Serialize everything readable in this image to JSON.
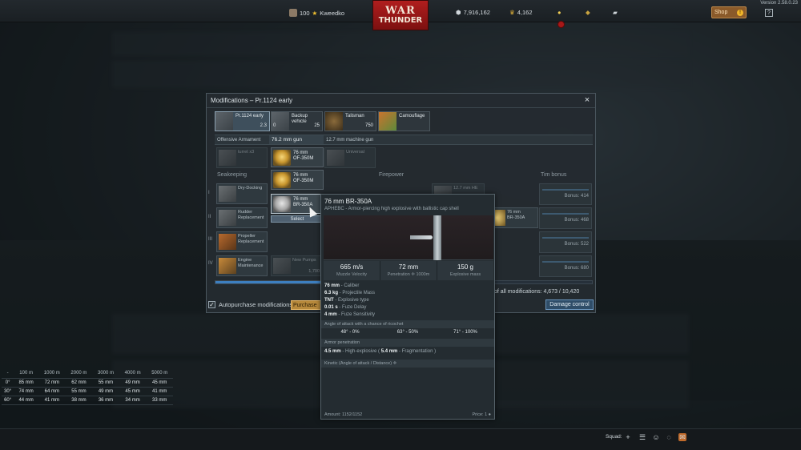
{
  "version": "Version 2.58.0.23",
  "topbar": {
    "rank": "100",
    "username": "Kweedko",
    "logo_top": "WAR",
    "logo_bottom": "THUNDER",
    "silver_lions": "7,916,162",
    "golden_eagles": "4,162",
    "shop_label": "Shop",
    "shop_badge": "!",
    "help_label": "?"
  },
  "modal": {
    "title": "Modifications – Pr.1124 early",
    "close": "×",
    "slots": [
      {
        "name": "Pr.1124 early",
        "sub": "2.3"
      },
      {
        "name": "Backup vehicle",
        "count": "0",
        "cost": "25"
      },
      {
        "name": "Talisman",
        "cost": "750"
      },
      {
        "name": "Camouflage"
      }
    ],
    "armament": {
      "label": "Offensive Armament",
      "weapon1": "76.2 mm gun",
      "weapon2": "12.7 mm machine gun"
    },
    "row0": {
      "turret": "turret x3",
      "universal": "Universal"
    },
    "shells": [
      {
        "line1": "76 mm",
        "line2": "OF-350M"
      },
      {
        "line1": "76 mm",
        "line2": "OF-350M"
      },
      {
        "line1": "76 mm",
        "line2": "BR-350A"
      }
    ],
    "select_label": "Select",
    "categories": {
      "seakeeping": "Seakeeping",
      "firepower": "Firepower",
      "tim_bonus": "Tim bonus"
    },
    "roman": [
      "I",
      "II",
      "III",
      "IV"
    ],
    "mods": [
      {
        "line1": "Dry-Docking",
        "line2": ""
      },
      {
        "line1": "Rudder",
        "line2": "Replacement"
      },
      {
        "line1": "Propeller",
        "line2": "Replacement"
      },
      {
        "line1": "Engine",
        "line2": "Maintenance"
      },
      {
        "line1": "New Pumps",
        "line2": "",
        "cost": "1,700"
      }
    ],
    "fp_cell1": "12.7 mm HE",
    "fp_cell2": {
      "line1": "76 mm",
      "line2": "BR-350A"
    },
    "tim_rows": [
      "Bonus: 414",
      "Bonus: 468",
      "Bonus: 522",
      "Bonus: 680"
    ],
    "cost_text": "of all modifications: 4,673 / 10,420",
    "progress_fraction": 0.45,
    "autopurchase": "Autopurchase modifications",
    "purchase_all": "Purchase All",
    "damage_control": "Damage control"
  },
  "tooltip": {
    "title": "76 mm BR-350A",
    "subtitle": "APHEBC - Armor-piercing high explosive with ballistic cap shell",
    "stats": [
      {
        "value": "665 m/s",
        "label": "Muzzle Velocity"
      },
      {
        "value": "72 mm",
        "label": "Penetration",
        "extra": "1000m"
      },
      {
        "value": "150 g",
        "label": "Explosive mass"
      }
    ],
    "props": [
      {
        "value": "76 mm",
        "label": " - Caliber"
      },
      {
        "value": "6.3 kg",
        "label": " - Projectile Mass"
      },
      {
        "value": "TNT",
        "label": " - Explosive type"
      },
      {
        "value": "0.01 s",
        "label": " - Fuze Delay"
      },
      {
        "value": "4 mm",
        "label": " - Fuze Sensitivity"
      }
    ],
    "ricochet_title": "Angle of attack with a chance of ricochet",
    "ricochet": [
      "48° - 0%",
      "63° - 50%",
      "71° - 100%"
    ],
    "armor_pen_title": "Armor penetration",
    "he_pen_value": "4.5 mm",
    "he_pen_label": " - High-explosive ( ",
    "frag_value": "5.4 mm",
    "frag_label": " - Fragmentation )",
    "kinetic_title": "Kinetic (Angle of attack / Distance)",
    "pen_header": [
      "-",
      "100 m",
      "1000 m",
      "2000 m",
      "3000 m",
      "4000 m",
      "5000 m"
    ],
    "pen_rows": [
      [
        "0°",
        "85 mm",
        "72 mm",
        "62 mm",
        "55 mm",
        "49 mm",
        "45 mm"
      ],
      [
        "30°",
        "74 mm",
        "64 mm",
        "55 mm",
        "49 mm",
        "45 mm",
        "41 mm"
      ],
      [
        "60°",
        "44 mm",
        "41 mm",
        "38 mm",
        "36 mm",
        "34 mm",
        "33 mm"
      ]
    ],
    "amount": "Amount: 1152/1152",
    "price": "Price: 1"
  },
  "bottombar": {
    "squad": "Squad:"
  },
  "colors": {
    "accent_blue": "#3d7fc0",
    "purchase_gold": "#b88a3c",
    "logo_red": "#b01e1e"
  }
}
